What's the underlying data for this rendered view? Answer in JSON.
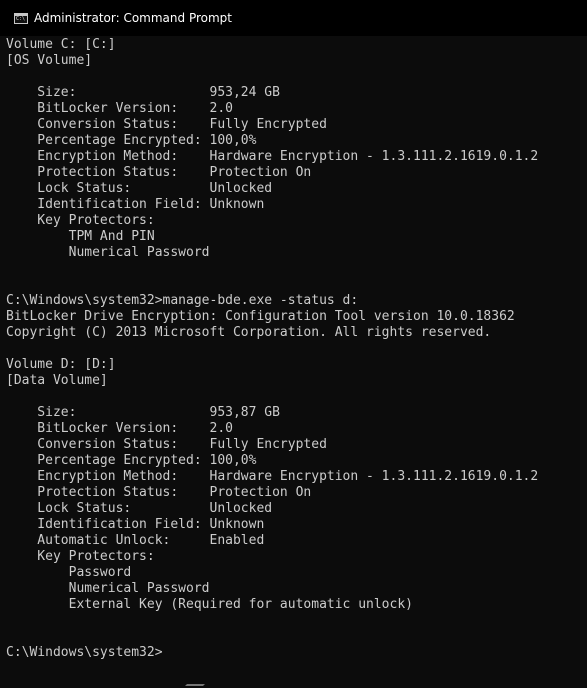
{
  "window": {
    "title": "Administrator: Command Prompt",
    "icon": "cmd-icon",
    "icon_text": "C:\\",
    "background": "#0c0c0c",
    "text_color": "#cccccc"
  },
  "console": {
    "lines": [
      "Volume C: [C:]",
      "[OS Volume]",
      "",
      "    Size:                 953,24 GB",
      "    BitLocker Version:    2.0",
      "    Conversion Status:    Fully Encrypted",
      "    Percentage Encrypted: 100,0%",
      "    Encryption Method:    Hardware Encryption - 1.3.111.2.1619.0.1.2",
      "    Protection Status:    Protection On",
      "    Lock Status:          Unlocked",
      "    Identification Field: Unknown",
      "    Key Protectors:",
      "        TPM And PIN",
      "        Numerical Password",
      "",
      "",
      "C:\\Windows\\system32>manage-bde.exe -status d:",
      "BitLocker Drive Encryption: Configuration Tool version 10.0.18362",
      "Copyright (C) 2013 Microsoft Corporation. All rights reserved.",
      "",
      "Volume D: [D:]",
      "[Data Volume]",
      "",
      "    Size:                 953,87 GB",
      "    BitLocker Version:    2.0",
      "    Conversion Status:    Fully Encrypted",
      "    Percentage Encrypted: 100,0%",
      "    Encryption Method:    Hardware Encryption - 1.3.111.2.1619.0.1.2",
      "    Protection Status:    Protection On",
      "    Lock Status:          Unlocked",
      "    Identification Field: Unknown",
      "    Automatic Unlock:     Enabled",
      "    Key Protectors:",
      "        Password",
      "        Numerical Password",
      "        External Key (Required for automatic unlock)",
      "",
      "",
      "C:\\Windows\\system32>"
    ]
  }
}
